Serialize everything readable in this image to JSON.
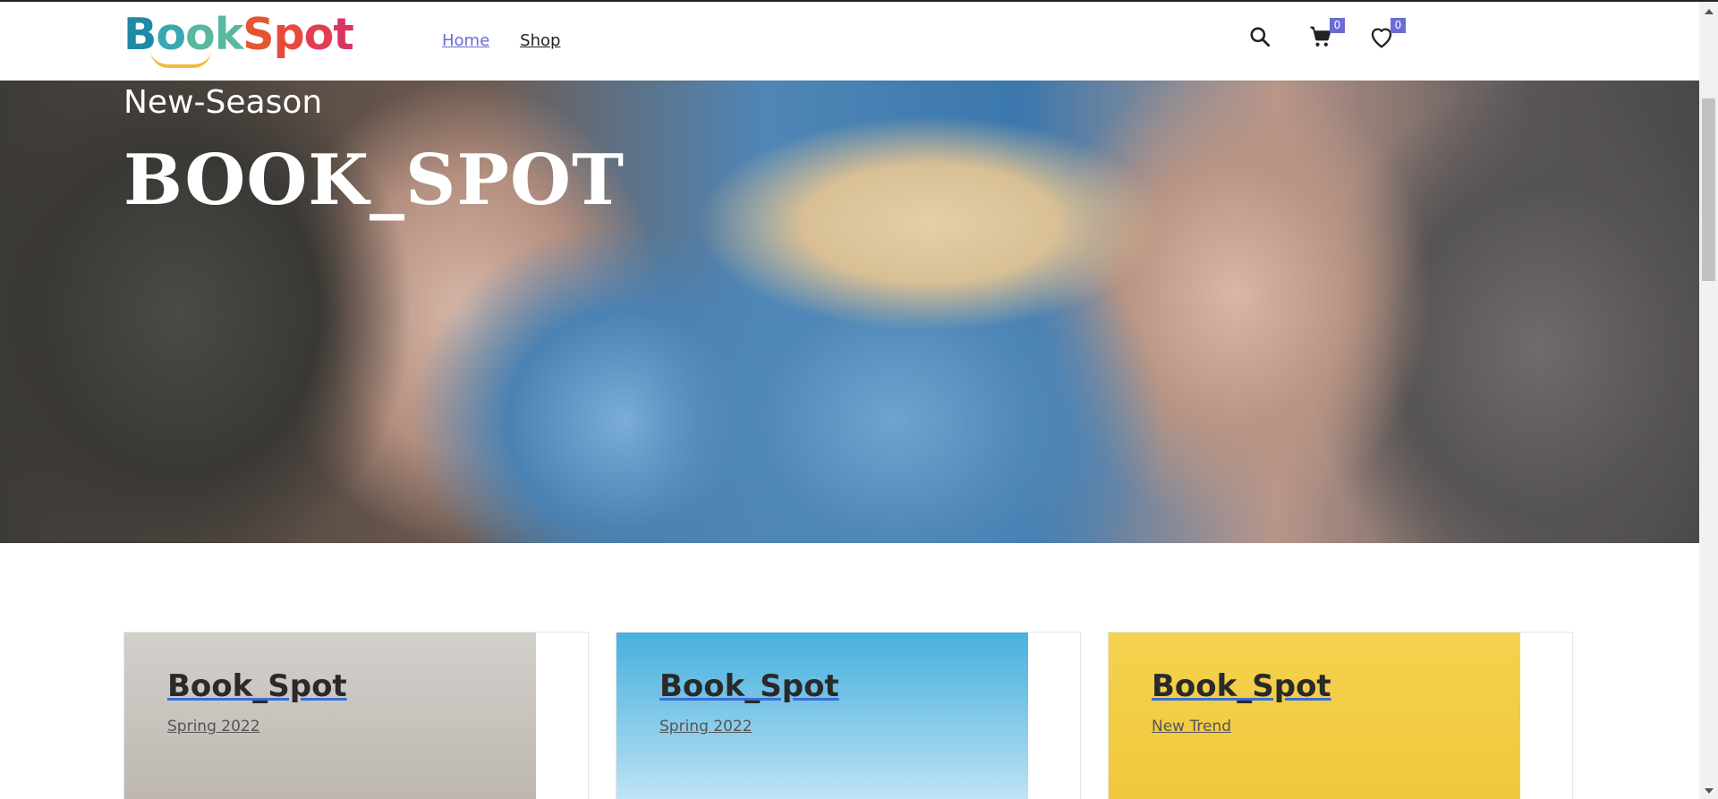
{
  "header": {
    "logo_text": "BookSpot",
    "nav": [
      {
        "label": "Home",
        "active": true
      },
      {
        "label": "Shop",
        "active": false
      }
    ],
    "icons": [
      {
        "name": "search-icon"
      },
      {
        "name": "cart-icon",
        "badge": "0"
      },
      {
        "name": "heart-icon",
        "badge": "0"
      }
    ],
    "accent_color": "#6b6bd6"
  },
  "hero": {
    "subtitle": "New-Season",
    "title": "BOOK_SPOT"
  },
  "cards": [
    {
      "title": "Book_Spot",
      "subtitle": "Spring 2022"
    },
    {
      "title": "Book_Spot",
      "subtitle": "Spring 2022"
    },
    {
      "title": "Book_Spot",
      "subtitle": "New Trend"
    }
  ]
}
